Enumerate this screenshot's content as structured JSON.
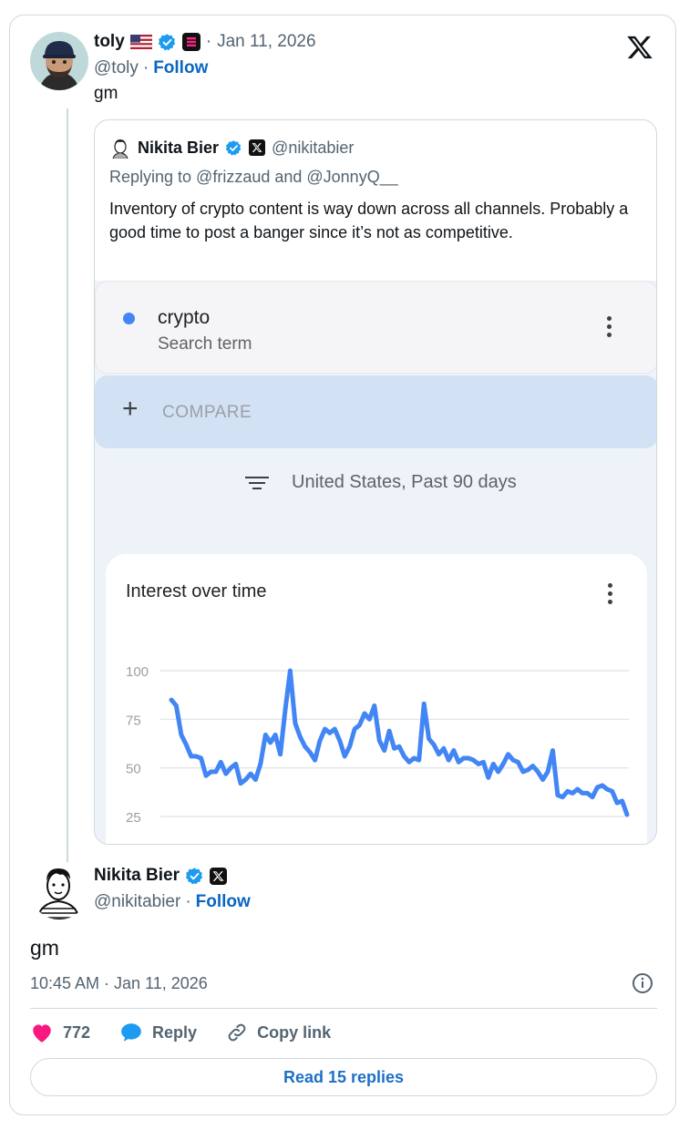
{
  "main_tweet": {
    "author_name": "toly",
    "handle": "@toly",
    "separator": "·",
    "date_sep": "·",
    "date": "Jan 11, 2026",
    "follow_label": "Follow",
    "text": "gm"
  },
  "quoted_tweet": {
    "author_name": "Nikita Bier",
    "handle": "@nikitabier",
    "replying_to": "Replying to @frizzaud and @JonnyQ__",
    "text": "Inventory of crypto content is way down across all channels. Probably a good time to post a banger since it’s not as competitive."
  },
  "google_trends": {
    "term": "crypto",
    "term_type": "Search term",
    "compare_label": "COMPARE",
    "filter_text": "United States, Past 90 days",
    "chart_title": "Interest over time"
  },
  "chart_data": {
    "type": "line",
    "title": "Interest over time",
    "xlabel": "",
    "ylabel": "",
    "yticks": [
      100,
      75,
      50,
      25
    ],
    "ylim": [
      25,
      100
    ],
    "grid": true,
    "series": [
      {
        "color": "#4285f4",
        "values": [
          85,
          82,
          67,
          62,
          56,
          56,
          55,
          46,
          48,
          48,
          53,
          47,
          50,
          52,
          42,
          44,
          47,
          44,
          52,
          67,
          63,
          67,
          57,
          80,
          100,
          73,
          66,
          61,
          58,
          54,
          64,
          70,
          68,
          70,
          64,
          56,
          61,
          70,
          72,
          78,
          75,
          82,
          64,
          59,
          69,
          60,
          61,
          56,
          53,
          55,
          54,
          83,
          65,
          62,
          57,
          60,
          54,
          59,
          53,
          55,
          55,
          54,
          52,
          53,
          45,
          52,
          48,
          52,
          57,
          54,
          53,
          48,
          49,
          51,
          48,
          44,
          48,
          59,
          36,
          35,
          38,
          37,
          39,
          37,
          37,
          35,
          40,
          41,
          39,
          38,
          32,
          33,
          26
        ]
      }
    ]
  },
  "reply_tweet": {
    "author_name": "Nikita Bier",
    "handle": "@nikitabier",
    "separator": "·",
    "follow_label": "Follow",
    "text": "gm",
    "timestamp": "10:45 AM · Jan 11, 2026"
  },
  "actions": {
    "likes": "772",
    "reply_label": "Reply",
    "copy_label": "Copy link"
  },
  "read_replies_label": "Read 15 replies",
  "colors": {
    "accent_blue": "#1d9bf0",
    "like_pink": "#f91880",
    "trend_line": "#4285f4"
  }
}
